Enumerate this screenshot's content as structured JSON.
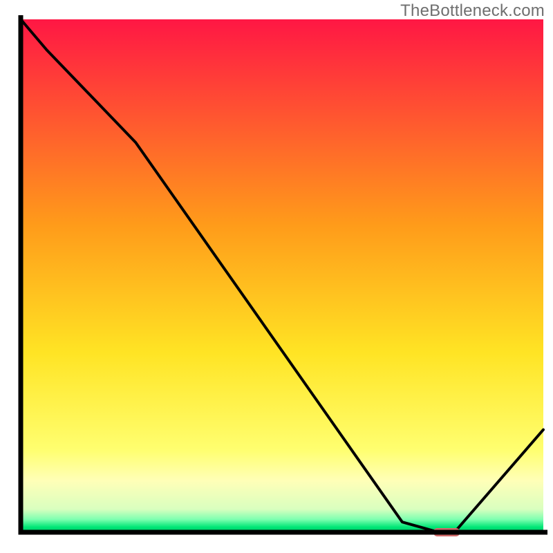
{
  "watermark": "TheBottleneck.com",
  "chart_data": {
    "type": "line",
    "title": "",
    "xlabel": "",
    "ylabel": "",
    "xlim": [
      0,
      100
    ],
    "ylim": [
      0,
      100
    ],
    "x": [
      0,
      5,
      22,
      73,
      80,
      83,
      100
    ],
    "y": [
      100,
      94,
      76,
      2,
      0,
      0,
      20
    ],
    "marker": {
      "x_start": 79,
      "x_end": 84,
      "y": 0,
      "color": "#d16a6a"
    },
    "gradient_stops": [
      {
        "offset": 0.0,
        "color": "#ff1744"
      },
      {
        "offset": 0.4,
        "color": "#ff9b1a"
      },
      {
        "offset": 0.65,
        "color": "#ffe424"
      },
      {
        "offset": 0.84,
        "color": "#ffff70"
      },
      {
        "offset": 0.9,
        "color": "#ffffb8"
      },
      {
        "offset": 0.955,
        "color": "#d9ffbf"
      },
      {
        "offset": 0.975,
        "color": "#7dffb0"
      },
      {
        "offset": 0.99,
        "color": "#00e676"
      },
      {
        "offset": 1.0,
        "color": "#00c666"
      }
    ],
    "axis_color": "#000000",
    "axis_width": 7,
    "line_color": "#000000",
    "line_width": 4
  }
}
